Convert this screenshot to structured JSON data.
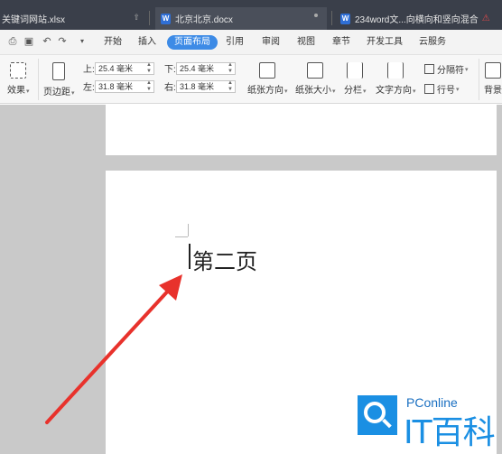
{
  "tabs": [
    {
      "label": "关键词网站.xlsx",
      "icon": "excel-file-icon",
      "active": false
    },
    {
      "label": "北京北京.docx",
      "icon": "word-file-icon",
      "active": true
    },
    {
      "label": "234word文...向横向和竖向混合",
      "icon": "word-file-icon",
      "active": false
    }
  ],
  "tab_icon_letter": "W",
  "menu": {
    "items": [
      "开始",
      "插入",
      "页面布局",
      "引用",
      "审阅",
      "视图",
      "章节",
      "开发工具",
      "云服务"
    ],
    "active": "页面布局",
    "active_color": "#3d8be6"
  },
  "ribbon": {
    "effects_label": "效果",
    "margins_label": "页边距",
    "margins": {
      "top_label": "上:",
      "top_value": "25.4 毫米",
      "left_label": "左:",
      "left_value": "31.8 毫米",
      "bottom_label": "下:",
      "bottom_value": "25.4 毫米",
      "right_label": "右:",
      "right_value": "31.8 毫米"
    },
    "orientation_label": "纸张方向",
    "size_label": "纸张大小",
    "columns_label": "分栏",
    "text_direction_label": "文字方向",
    "separator_label": "分隔符",
    "line_number_label": "行号",
    "background_label": "背景"
  },
  "document": {
    "page2_text": "第二页"
  },
  "watermark": {
    "brand_top": "PConline",
    "brand_main": "IT百科"
  },
  "colors": {
    "arrow": "#e8322c",
    "brand": "#1a8fe3"
  }
}
